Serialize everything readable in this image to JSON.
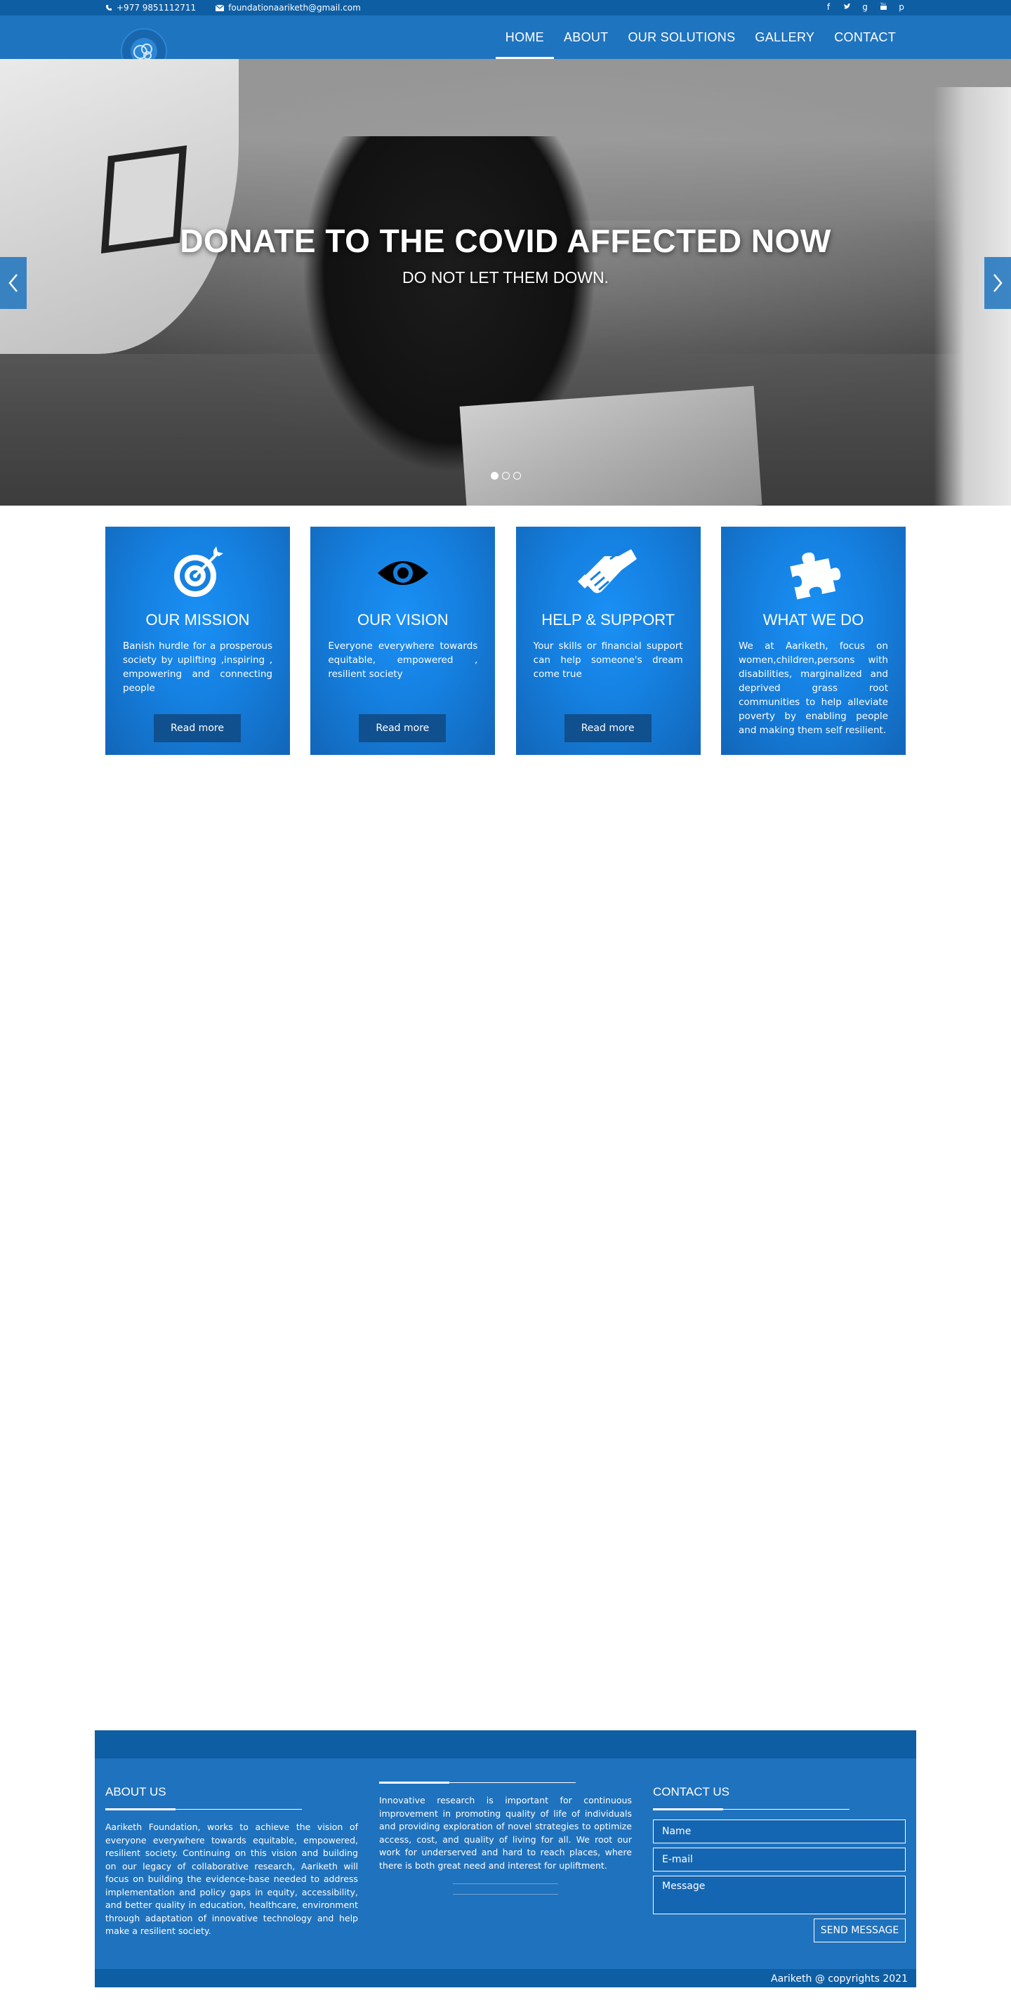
{
  "topbar": {
    "phone": "+977 9851112711",
    "email": "foundationaariketh@gmail.com",
    "social": [
      "facebook-icon",
      "twitter-icon",
      "google-plus-icon",
      "youtube-icon",
      "pinterest-icon"
    ]
  },
  "nav": {
    "items": [
      {
        "label": "HOME",
        "active": true
      },
      {
        "label": "ABOUT",
        "active": false
      },
      {
        "label": "OUR SOLUTIONS",
        "active": false
      },
      {
        "label": "GALLERY",
        "active": false
      },
      {
        "label": "CONTACT",
        "active": false
      }
    ]
  },
  "hero": {
    "title": "DONATE TO THE COVID AFFECTED NOW",
    "subtitle": "DO NOT LET THEM DOWN.",
    "slides": 3,
    "active_slide": 1
  },
  "cards": [
    {
      "title": "OUR MISSION",
      "text": "Banish hurdle for a prosperous society by uplifting ,inspiring , empowering and connecting people",
      "button": "Read more",
      "icon": "target-icon"
    },
    {
      "title": "OUR VISION",
      "text": "Everyone everywhere towards equitable, empowered , resilient society",
      "button": "Read more",
      "icon": "eye-icon"
    },
    {
      "title": "HELP & SUPPORT",
      "text": "Your skills or financial support can help someone's dream come true",
      "button": "Read more",
      "icon": "handshake-icon"
    },
    {
      "title": "WHAT WE DO",
      "text": "We at Aariketh, focus on women,children,persons with disabilities, marginalized and deprived grass root communities to help alleviate poverty by enabling people and making them self resilient.",
      "button": "",
      "icon": "puzzle-icon"
    }
  ],
  "footer": {
    "about_title": "ABOUT US",
    "about_text": "Aariketh Foundation, works to achieve the vision of everyone everywhere towards equitable, empowered, resilient society. Continuing on this vision and building on our legacy of collaborative research, Aariketh will focus on building the evidence-base needed to address implementation and policy gaps in equity, accessibility, and better quality in education, healthcare, environment through adaptation of innovative technology and help make a resilient society.",
    "research_text": "Innovative research is important for continuous improvement in promoting quality of life of individuals and providing exploration of novel strategies to optimize access, cost, and quality of living for all. We root our work for underserved and hard to reach places, where there is both great need and interest for upliftment.",
    "contact_title": "CONTACT US",
    "name_placeholder": "Name",
    "email_placeholder": "E-mail",
    "message_placeholder": "Message",
    "send_label": "SEND MESSAGE",
    "copyright": "Aariketh @ copyrights 2021"
  }
}
